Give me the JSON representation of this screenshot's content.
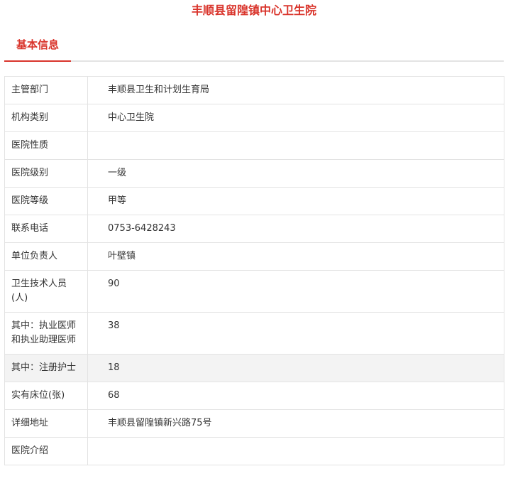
{
  "page_title": "丰顺县留隍镇中心卫生院",
  "tab": {
    "label": "基本信息"
  },
  "rows": [
    {
      "label": "主管部门",
      "value": "丰顺县卫生和计划生育局"
    },
    {
      "label": "机构类别",
      "value": "中心卫生院"
    },
    {
      "label": "医院性质",
      "value": ""
    },
    {
      "label": "医院级别",
      "value": "一级"
    },
    {
      "label": "医院等级",
      "value": "甲等"
    },
    {
      "label": "联系电话",
      "value": "0753-6428243"
    },
    {
      "label": "单位负责人",
      "value": "叶壁镇"
    },
    {
      "label": "卫生技术人员(人)",
      "value": "90"
    },
    {
      "label": "其中：执业医师和执业助理医师",
      "value": "38"
    },
    {
      "label": "其中：注册护士",
      "value": "18"
    },
    {
      "label": "实有床位(张)",
      "value": "68"
    },
    {
      "label": "详细地址",
      "value": "丰顺县留隍镇新兴路75号"
    },
    {
      "label": "医院介绍",
      "value": ""
    }
  ],
  "colors": {
    "accent": "#d9342b",
    "border": "#e3e3e3",
    "shaded_row": "#f3f3f3",
    "text": "#333333"
  }
}
